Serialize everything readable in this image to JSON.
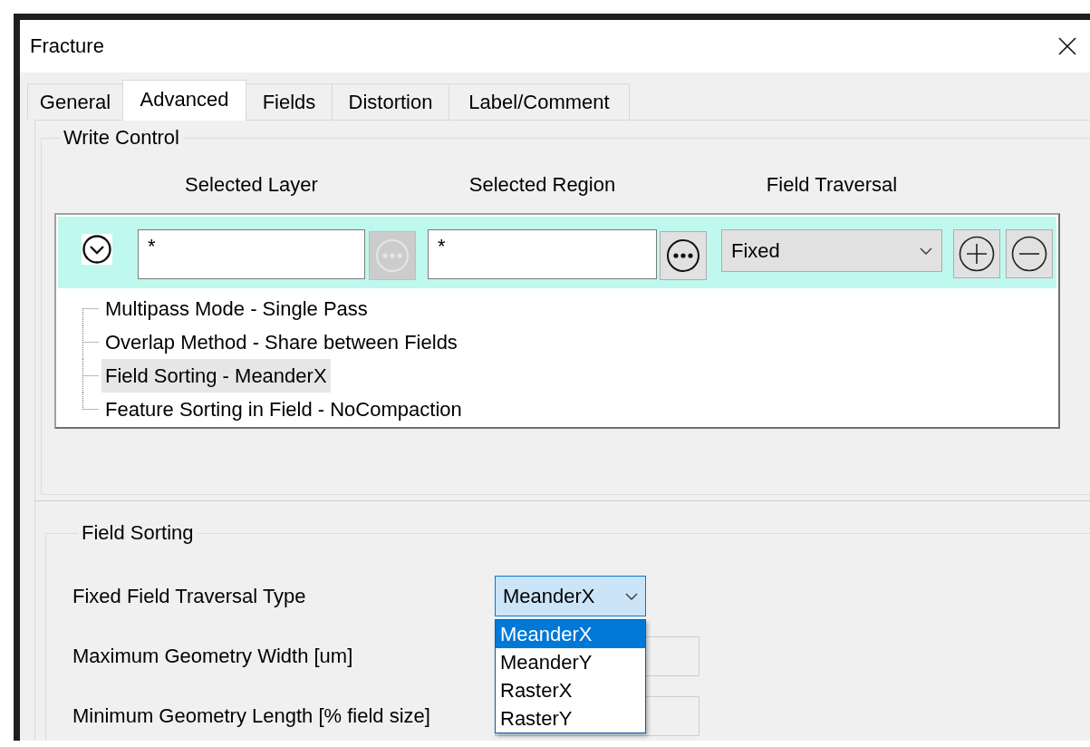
{
  "window": {
    "title": "Fracture"
  },
  "tabs": [
    {
      "label": "General",
      "selected": false
    },
    {
      "label": "Advanced",
      "selected": true
    },
    {
      "label": "Fields",
      "selected": false
    },
    {
      "label": "Distortion",
      "selected": false
    },
    {
      "label": "Label/Comment",
      "selected": false
    }
  ],
  "write_control": {
    "title": "Write Control",
    "columns": [
      "Selected Layer",
      "Selected Region",
      "Field Traversal"
    ],
    "row": {
      "expanded": true,
      "layer": "*",
      "layer_browse_disabled": true,
      "region": "*",
      "region_browse_disabled": false,
      "traversal": "Fixed"
    },
    "tree": [
      {
        "label": "Multipass Mode - Single Pass",
        "selected": false
      },
      {
        "label": "Overlap Method - Share between Fields",
        "selected": false
      },
      {
        "label": "Field Sorting - MeanderX",
        "selected": true
      },
      {
        "label": "Feature Sorting in Field - NoCompaction",
        "selected": false
      }
    ]
  },
  "field_sorting": {
    "title": "Field Sorting",
    "traversal_type": {
      "label": "Fixed Field Traversal Type",
      "value": "MeanderX",
      "open": true,
      "options": [
        {
          "label": "MeanderX",
          "selected": true
        },
        {
          "label": "MeanderY",
          "selected": false
        },
        {
          "label": "RasterX",
          "selected": false
        },
        {
          "label": "RasterY",
          "selected": false
        }
      ]
    },
    "fields": [
      {
        "label": "Maximum Geometry Width [um]"
      },
      {
        "label": "Minimum Geometry Length [% field size]"
      }
    ]
  }
}
